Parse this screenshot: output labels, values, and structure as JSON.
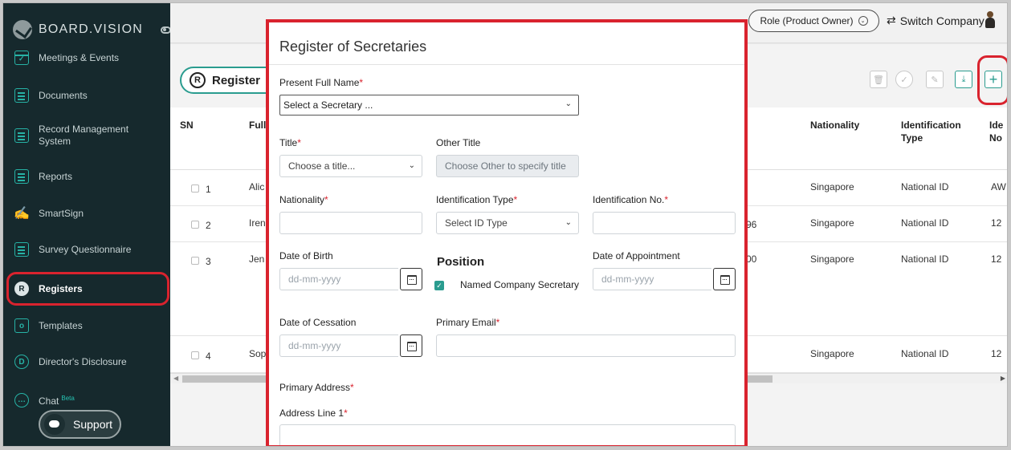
{
  "brand": {
    "name": "BOARD.VISION"
  },
  "sidebar": {
    "items": [
      {
        "label": "Meetings & Events"
      },
      {
        "label": "Documents"
      },
      {
        "label": "Record Management System"
      },
      {
        "label": "Reports"
      },
      {
        "label": "SmartSign"
      },
      {
        "label": "Survey Questionnaire"
      },
      {
        "label": "Registers"
      },
      {
        "label": "Templates"
      },
      {
        "label": "Director's Disclosure"
      },
      {
        "label": "Chat",
        "badge": "Beta"
      }
    ],
    "support_label": "Support"
  },
  "topbar": {
    "role_label": "Role (Product Owner)",
    "switch_label": "Switch Company"
  },
  "main": {
    "register_pill": "Register",
    "table": {
      "headers": [
        "SN",
        "Full",
        "Nationality",
        "Identification Type",
        "Ide No"
      ],
      "rows": [
        {
          "sn": "1",
          "name": "Alic",
          "mid": "",
          "nationality": "Singapore",
          "id_type": "National ID",
          "id_no": "AW"
        },
        {
          "sn": "2",
          "name": "Iren",
          "mid": "96",
          "nationality": "Singapore",
          "id_type": "National ID",
          "id_no": "12"
        },
        {
          "sn": "3",
          "name": "Jen",
          "mid": "00",
          "nationality": "Singapore",
          "id_type": "National ID",
          "id_no": "12"
        },
        {
          "sn": "4",
          "name": "Sop",
          "mid": "",
          "nationality": "Singapore",
          "id_type": "National ID",
          "id_no": "12"
        }
      ]
    }
  },
  "modal": {
    "title": "Register of Secretaries",
    "present_full_name_label": "Present Full Name",
    "present_full_name_value": "Select a Secretary ...",
    "title_label": "Title",
    "title_placeholder": "Choose a title...",
    "other_title_label": "Other Title",
    "other_title_placeholder": "Choose Other to specify title",
    "nationality_label": "Nationality",
    "id_type_label": "Identification Type",
    "id_type_placeholder": "Select ID Type",
    "id_no_label": "Identification No.",
    "dob_label": "Date of Birth",
    "date_placeholder": "dd-mm-yyyy",
    "position_label": "Position",
    "named_secretary_label": "Named Company Secretary",
    "doa_label": "Date of Appointment",
    "doc_label": "Date of Cessation",
    "primary_email_label": "Primary Email",
    "primary_address_label": "Primary Address",
    "address_line1_label": "Address Line 1",
    "required_mark": "*"
  }
}
